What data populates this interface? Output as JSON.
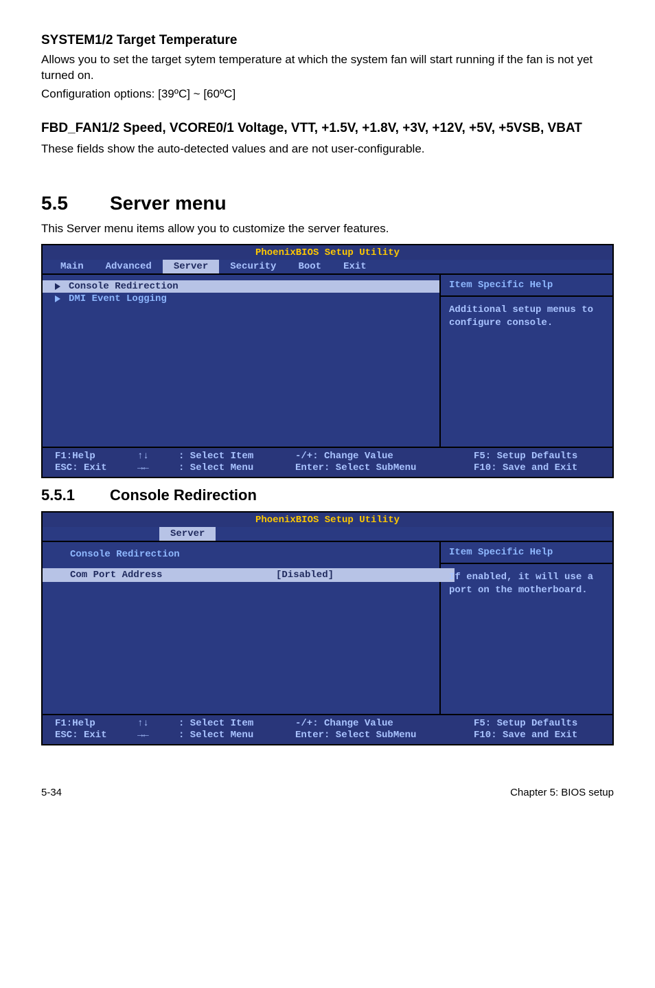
{
  "section1": {
    "heading": "SYSTEM1/2 Target Temperature",
    "p1": "Allows you to set the target sytem temperature at which the system fan will start running if the fan is not yet turned on.",
    "p2": "Configuration options: [39ºC] ~ [60ºC]"
  },
  "section2": {
    "heading": "FBD_FAN1/2 Speed, VCORE0/1 Voltage, VTT, +1.5V, +1.8V, +3V, +12V, +5V, +5VSB, VBAT",
    "p1": "These fields show the auto-detected values and are not user-configurable."
  },
  "servermenu": {
    "number": "5.5",
    "title": "Server menu",
    "desc": "This Server menu items allow you to customize the server features."
  },
  "bios1": {
    "title": "PhoenixBIOS Setup Utility",
    "tabs": [
      "Main",
      "Advanced",
      "Server",
      "Security",
      "Boot",
      "Exit"
    ],
    "selectedTab": "Server",
    "left": {
      "item1": "Console Redirection",
      "item2": "DMI Event Logging"
    },
    "helpHeader": "Item Specific Help",
    "helpBody": "Additional setup menus to configure console.",
    "footer": {
      "f1": "F1:Help",
      "udarrows": "↑↓",
      "selectItem": ": Select Item",
      "changeValue": "-/+: Change Value",
      "f5": "F5: Setup Defaults",
      "esc": "ESC: Exit",
      "lrarrows": "→←",
      "selectMenu": ": Select Menu",
      "enterSub": "Enter: Select SubMenu",
      "f10": "F10: Save and Exit"
    }
  },
  "subsection": {
    "number": "5.5.1",
    "title": "Console Redirection"
  },
  "bios2": {
    "title": "PhoenixBIOS Setup Utility",
    "tabOnly": "Server",
    "left": {
      "header": "Console Redirection",
      "key1": "Com Port Address",
      "val1": "[Disabled]"
    },
    "helpHeader": "Item Specific Help",
    "helpBody": "If enabled, it will use a port on the motherboard.",
    "footer": {
      "f1": "F1:Help",
      "udarrows": "↑↓",
      "selectItem": ": Select Item",
      "changeValue": "-/+: Change Value",
      "f5": "F5: Setup Defaults",
      "esc": "ESC: Exit",
      "lrarrows": "→←",
      "selectMenu": ": Select Menu",
      "enterSub": "Enter: Select SubMenu",
      "f10": "F10: Save and Exit"
    }
  },
  "footer": {
    "left": "5-34",
    "right": "Chapter 5: BIOS setup"
  }
}
